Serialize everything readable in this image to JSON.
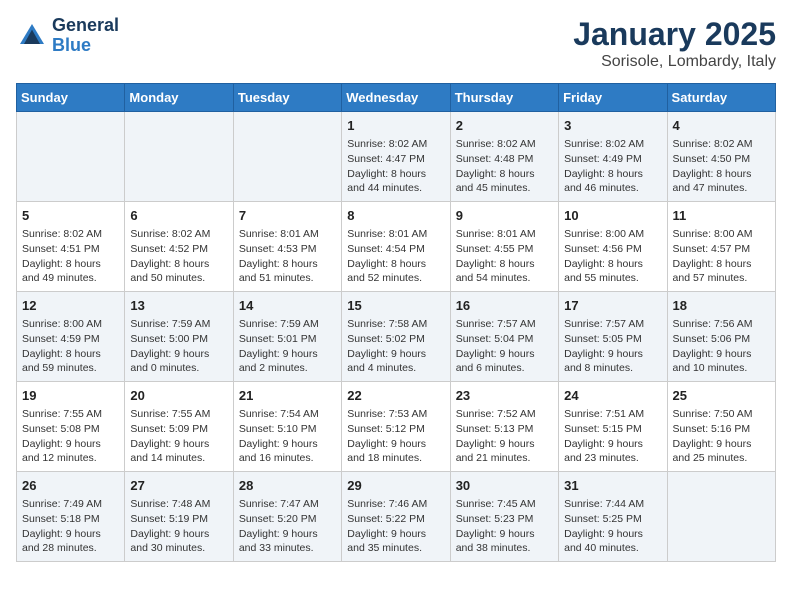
{
  "logo": {
    "line1": "General",
    "line2": "Blue"
  },
  "title": "January 2025",
  "subtitle": "Sorisole, Lombardy, Italy",
  "weekdays": [
    "Sunday",
    "Monday",
    "Tuesday",
    "Wednesday",
    "Thursday",
    "Friday",
    "Saturday"
  ],
  "weeks": [
    [
      {
        "day": "",
        "info": ""
      },
      {
        "day": "",
        "info": ""
      },
      {
        "day": "",
        "info": ""
      },
      {
        "day": "1",
        "info": "Sunrise: 8:02 AM\nSunset: 4:47 PM\nDaylight: 8 hours\nand 44 minutes."
      },
      {
        "day": "2",
        "info": "Sunrise: 8:02 AM\nSunset: 4:48 PM\nDaylight: 8 hours\nand 45 minutes."
      },
      {
        "day": "3",
        "info": "Sunrise: 8:02 AM\nSunset: 4:49 PM\nDaylight: 8 hours\nand 46 minutes."
      },
      {
        "day": "4",
        "info": "Sunrise: 8:02 AM\nSunset: 4:50 PM\nDaylight: 8 hours\nand 47 minutes."
      }
    ],
    [
      {
        "day": "5",
        "info": "Sunrise: 8:02 AM\nSunset: 4:51 PM\nDaylight: 8 hours\nand 49 minutes."
      },
      {
        "day": "6",
        "info": "Sunrise: 8:02 AM\nSunset: 4:52 PM\nDaylight: 8 hours\nand 50 minutes."
      },
      {
        "day": "7",
        "info": "Sunrise: 8:01 AM\nSunset: 4:53 PM\nDaylight: 8 hours\nand 51 minutes."
      },
      {
        "day": "8",
        "info": "Sunrise: 8:01 AM\nSunset: 4:54 PM\nDaylight: 8 hours\nand 52 minutes."
      },
      {
        "day": "9",
        "info": "Sunrise: 8:01 AM\nSunset: 4:55 PM\nDaylight: 8 hours\nand 54 minutes."
      },
      {
        "day": "10",
        "info": "Sunrise: 8:00 AM\nSunset: 4:56 PM\nDaylight: 8 hours\nand 55 minutes."
      },
      {
        "day": "11",
        "info": "Sunrise: 8:00 AM\nSunset: 4:57 PM\nDaylight: 8 hours\nand 57 minutes."
      }
    ],
    [
      {
        "day": "12",
        "info": "Sunrise: 8:00 AM\nSunset: 4:59 PM\nDaylight: 8 hours\nand 59 minutes."
      },
      {
        "day": "13",
        "info": "Sunrise: 7:59 AM\nSunset: 5:00 PM\nDaylight: 9 hours\nand 0 minutes."
      },
      {
        "day": "14",
        "info": "Sunrise: 7:59 AM\nSunset: 5:01 PM\nDaylight: 9 hours\nand 2 minutes."
      },
      {
        "day": "15",
        "info": "Sunrise: 7:58 AM\nSunset: 5:02 PM\nDaylight: 9 hours\nand 4 minutes."
      },
      {
        "day": "16",
        "info": "Sunrise: 7:57 AM\nSunset: 5:04 PM\nDaylight: 9 hours\nand 6 minutes."
      },
      {
        "day": "17",
        "info": "Sunrise: 7:57 AM\nSunset: 5:05 PM\nDaylight: 9 hours\nand 8 minutes."
      },
      {
        "day": "18",
        "info": "Sunrise: 7:56 AM\nSunset: 5:06 PM\nDaylight: 9 hours\nand 10 minutes."
      }
    ],
    [
      {
        "day": "19",
        "info": "Sunrise: 7:55 AM\nSunset: 5:08 PM\nDaylight: 9 hours\nand 12 minutes."
      },
      {
        "day": "20",
        "info": "Sunrise: 7:55 AM\nSunset: 5:09 PM\nDaylight: 9 hours\nand 14 minutes."
      },
      {
        "day": "21",
        "info": "Sunrise: 7:54 AM\nSunset: 5:10 PM\nDaylight: 9 hours\nand 16 minutes."
      },
      {
        "day": "22",
        "info": "Sunrise: 7:53 AM\nSunset: 5:12 PM\nDaylight: 9 hours\nand 18 minutes."
      },
      {
        "day": "23",
        "info": "Sunrise: 7:52 AM\nSunset: 5:13 PM\nDaylight: 9 hours\nand 21 minutes."
      },
      {
        "day": "24",
        "info": "Sunrise: 7:51 AM\nSunset: 5:15 PM\nDaylight: 9 hours\nand 23 minutes."
      },
      {
        "day": "25",
        "info": "Sunrise: 7:50 AM\nSunset: 5:16 PM\nDaylight: 9 hours\nand 25 minutes."
      }
    ],
    [
      {
        "day": "26",
        "info": "Sunrise: 7:49 AM\nSunset: 5:18 PM\nDaylight: 9 hours\nand 28 minutes."
      },
      {
        "day": "27",
        "info": "Sunrise: 7:48 AM\nSunset: 5:19 PM\nDaylight: 9 hours\nand 30 minutes."
      },
      {
        "day": "28",
        "info": "Sunrise: 7:47 AM\nSunset: 5:20 PM\nDaylight: 9 hours\nand 33 minutes."
      },
      {
        "day": "29",
        "info": "Sunrise: 7:46 AM\nSunset: 5:22 PM\nDaylight: 9 hours\nand 35 minutes."
      },
      {
        "day": "30",
        "info": "Sunrise: 7:45 AM\nSunset: 5:23 PM\nDaylight: 9 hours\nand 38 minutes."
      },
      {
        "day": "31",
        "info": "Sunrise: 7:44 AM\nSunset: 5:25 PM\nDaylight: 9 hours\nand 40 minutes."
      },
      {
        "day": "",
        "info": ""
      }
    ]
  ]
}
